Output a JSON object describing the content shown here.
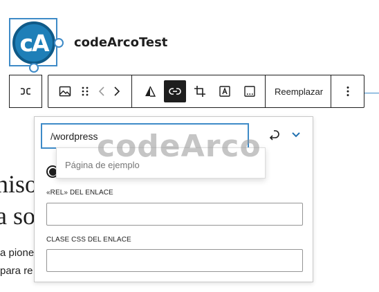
{
  "header": {
    "logo_text": "cA",
    "site_title": "codeArcoTest"
  },
  "toolbar": {
    "parent_icon": "parent-select-icon",
    "items": [
      {
        "name": "image-icon",
        "active": false
      },
      {
        "name": "drag-handle-icon",
        "active": false
      },
      {
        "name": "move-left-icon",
        "active": false
      },
      {
        "name": "move-right-icon",
        "active": false
      },
      {
        "name": "duotone-icon",
        "active": false
      },
      {
        "name": "link-icon",
        "active": true
      },
      {
        "name": "crop-icon",
        "active": false
      },
      {
        "name": "text-overlay-icon",
        "active": false
      },
      {
        "name": "caption-icon",
        "active": false
      }
    ],
    "replace_label": "Reemplazar",
    "more_icon": "more-options-icon"
  },
  "background": {
    "heading_line1": "niso",
    "heading_line2": "a so",
    "para_line1": "a pione",
    "para_line2": "para re"
  },
  "popover": {
    "url_value": "/wordpress",
    "submit_icon": "submit-enter-icon",
    "toggle_icon": "chevron-down-icon",
    "rel_label": "«REL» DEL ENLACE",
    "rel_value": "",
    "css_label": "CLASE CSS DEL ENLACE",
    "css_value": ""
  },
  "suggestions": {
    "items": [
      "Página de ejemplo"
    ]
  },
  "watermark": "codeArco"
}
